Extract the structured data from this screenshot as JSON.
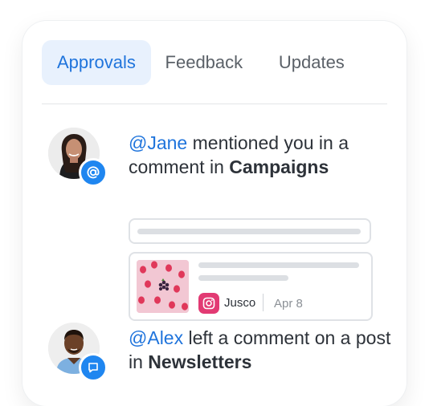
{
  "tabs": [
    {
      "label": "Approvals",
      "active": true
    },
    {
      "label": "Feedback",
      "active": false
    },
    {
      "label": "Updates",
      "active": false
    }
  ],
  "notifications": [
    {
      "mention": "@Jane",
      "text": " mentioned you in a comment in ",
      "target": "Campaigns",
      "badge_icon": "at-icon",
      "post": {
        "account": "Jusco",
        "date": "Apr 8",
        "network_icon": "instagram-icon"
      }
    },
    {
      "mention": "@Alex",
      "text": " left a comment on a post in ",
      "target": "Newsletters",
      "badge_icon": "comment-icon"
    }
  ],
  "colors": {
    "accent": "#1f74dc",
    "active_tab_bg": "#e8f1fd",
    "badge": "#1f86f0",
    "instagram": "#e23a73"
  }
}
